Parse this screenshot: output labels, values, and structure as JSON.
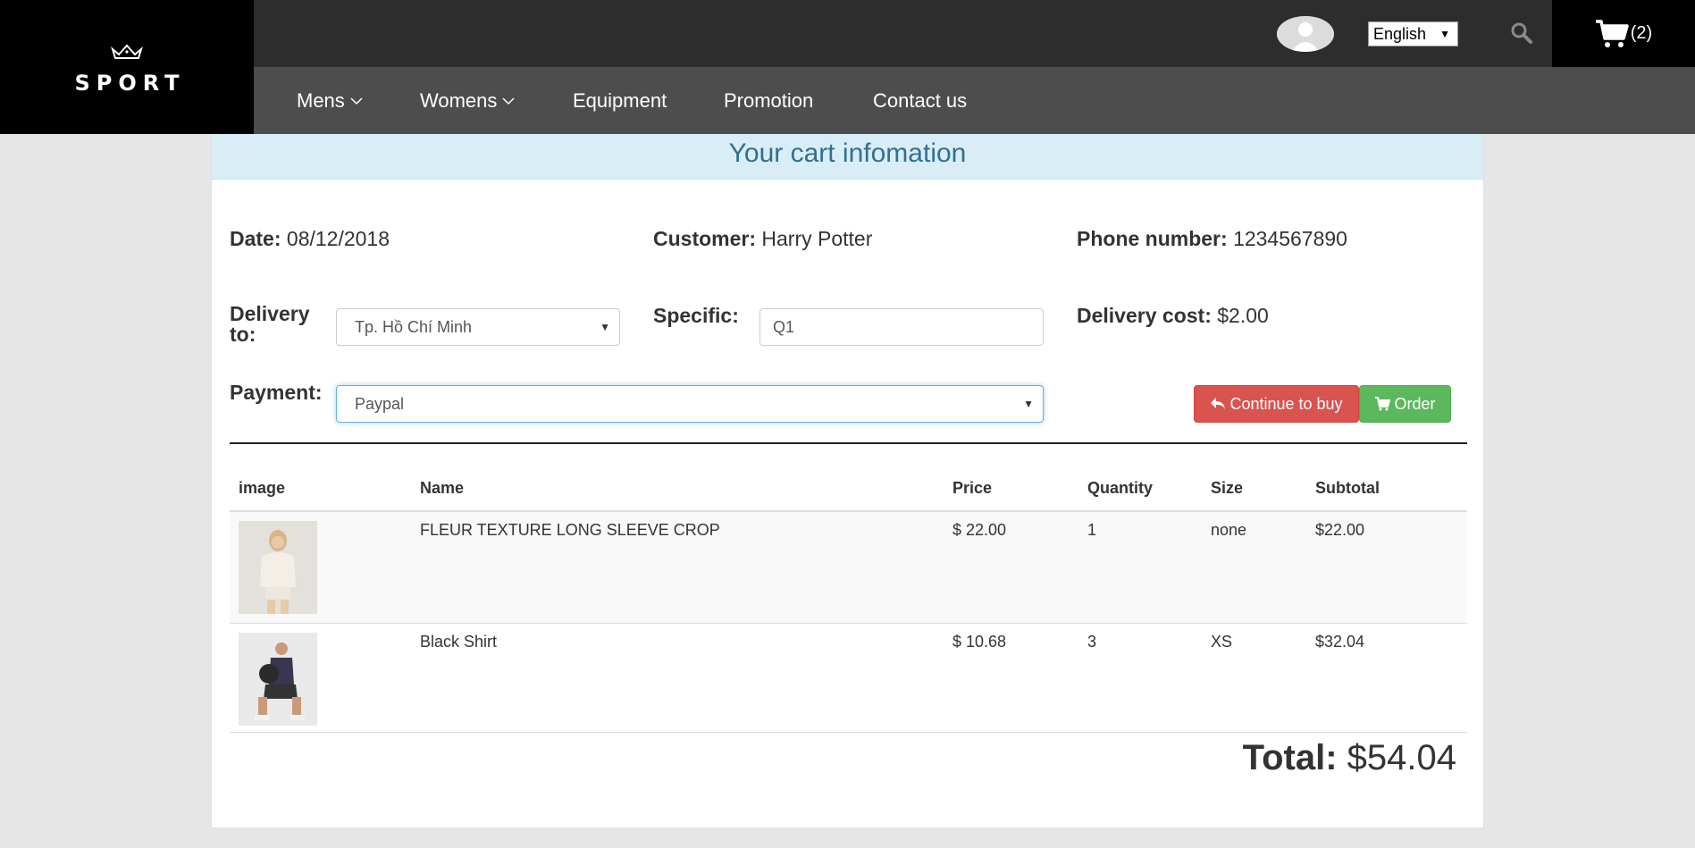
{
  "brand": {
    "name": "SPORT",
    "logo_icon": "crown-icon"
  },
  "header": {
    "language": "English",
    "cart_count": "(2)",
    "icons": {
      "avatar": "user-avatar",
      "search": "search-icon",
      "cart": "cart-icon"
    }
  },
  "nav": {
    "items": [
      {
        "label": "Mens",
        "has_dropdown": true
      },
      {
        "label": "Womens",
        "has_dropdown": true
      },
      {
        "label": "Equipment",
        "has_dropdown": false
      },
      {
        "label": "Promotion",
        "has_dropdown": false
      },
      {
        "label": "Contact us",
        "has_dropdown": false
      }
    ]
  },
  "cart": {
    "title": "Your cart infomation",
    "date_label": "Date:",
    "date_value": "08/12/2018",
    "customer_label": "Customer:",
    "customer_value": "Harry Potter",
    "phone_label": "Phone number:",
    "phone_value": "1234567890",
    "delivery_label_1": "Delivery",
    "delivery_label_2": "to:",
    "delivery_value": "Tp. Hồ Chí Minh",
    "specific_label": "Specific:",
    "specific_value": "Q1",
    "delivery_cost_label": "Delivery cost:",
    "delivery_cost_value": "$2.00",
    "payment_label": "Payment:",
    "payment_value": "Paypal",
    "continue_button": "Continue to buy",
    "order_button": "Order",
    "table": {
      "headers": [
        "image",
        "Name",
        "Price",
        "Quantity",
        "Size",
        "Subtotal"
      ],
      "rows": [
        {
          "name": "FLEUR TEXTURE LONG SLEEVE CROP",
          "price": "$ 22.00",
          "quantity": "1",
          "size": "none",
          "subtotal": "$22.00"
        },
        {
          "name": "Black Shirt",
          "price": "$ 10.68",
          "quantity": "3",
          "size": "XS",
          "subtotal": "$32.04"
        }
      ]
    },
    "total_label": "Total:",
    "total_value": "$54.04"
  },
  "colors": {
    "header_dark": "#2d2d2d",
    "nav_bg": "#4d4d4d",
    "panel_heading": "#d9edf7",
    "heading_text": "#31708f",
    "btn_danger": "#d9534f",
    "btn_success": "#5cb85c"
  }
}
